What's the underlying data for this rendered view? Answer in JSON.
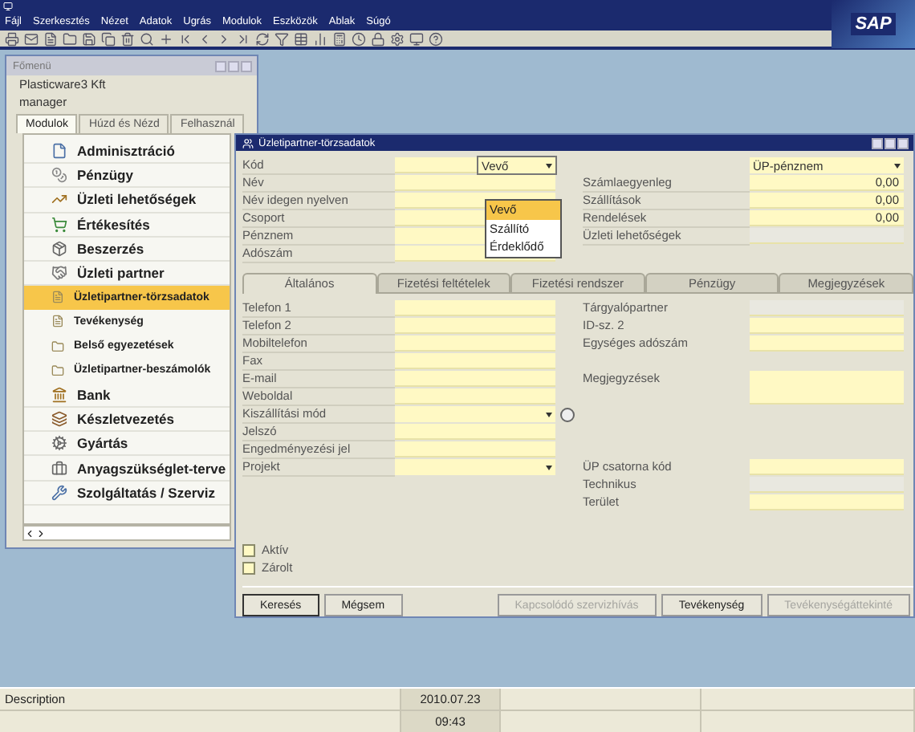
{
  "app": {
    "logo": "SAP",
    "menu": [
      "Fájl",
      "Szerkesztés",
      "Nézet",
      "Adatok",
      "Ugrás",
      "Modulok",
      "Eszközök",
      "Ablak",
      "Súgó"
    ]
  },
  "main_menu": {
    "title": "Főmenü",
    "company": "Plasticware3 Kft",
    "user": "manager",
    "tabs": [
      {
        "label": "Modulok",
        "selected": true
      },
      {
        "label": "Húzd és Nézd",
        "selected": false
      },
      {
        "label": "Felhasznál",
        "selected": false
      }
    ],
    "modules": [
      {
        "label": "Adminisztráció",
        "selected": false
      },
      {
        "label": "Pénzügy",
        "selected": false
      },
      {
        "label": "Üzleti lehetőségek",
        "selected": false
      },
      {
        "label": "Értékesítés",
        "selected": false
      },
      {
        "label": "Beszerzés",
        "selected": false
      },
      {
        "label": "Üzleti partner",
        "selected": false,
        "children": [
          {
            "label": "Üzletipartner-törzsadatok",
            "selected": true
          },
          {
            "label": "Tevékenység",
            "selected": false
          },
          {
            "label": "Belső egyezetések",
            "selected": false
          },
          {
            "label": "Üzletipartner-beszámolók",
            "selected": false
          }
        ]
      },
      {
        "label": "Bank",
        "selected": false
      },
      {
        "label": "Készletvezetés",
        "selected": false
      },
      {
        "label": "Gyártás",
        "selected": false
      },
      {
        "label": "Anyagszükséglet-terve",
        "selected": false
      },
      {
        "label": "Szolgáltatás / Szerviz",
        "selected": false
      }
    ]
  },
  "form": {
    "title": "Üzletipartner-törzsadatok",
    "code": {
      "label": "Kód",
      "type": "Vevő",
      "expanded": true,
      "options": [
        {
          "label": "Vevő",
          "selected": true
        },
        {
          "label": "Szállító",
          "selected": false
        },
        {
          "label": "Érdeklődő",
          "selected": false
        }
      ]
    },
    "header_left": [
      {
        "label": "Név",
        "kind": "text"
      },
      {
        "label": "Név idegen nyelven",
        "kind": "text"
      },
      {
        "label": "Csoport",
        "kind": "text"
      },
      {
        "label": "Pénznem",
        "kind": "dropdown"
      },
      {
        "label": "Adószám",
        "kind": "text"
      }
    ],
    "currency": "ÜP-pénznem",
    "header_right": [
      {
        "label": "Számlaegyenleg",
        "value": "0,00",
        "disabled": false
      },
      {
        "label": "Szállítások",
        "value": "0,00",
        "disabled": false
      },
      {
        "label": "Rendelések",
        "value": "0,00",
        "disabled": false
      },
      {
        "label": "Üzleti lehetőségek",
        "disabled": true
      }
    ],
    "tabs": [
      {
        "label": "Általános",
        "selected": true
      },
      {
        "label": "Fizetési feltételek",
        "selected": false
      },
      {
        "label": "Fizetési rendszer",
        "selected": false
      },
      {
        "label": "Pénzügy",
        "selected": false
      },
      {
        "label": "Megjegyzések",
        "selected": false
      }
    ],
    "general_left": [
      {
        "label": "Telefon 1",
        "kind": "text"
      },
      {
        "label": "Telefon 2",
        "kind": "text"
      },
      {
        "label": "Mobiltelefon",
        "kind": "text"
      },
      {
        "label": "Fax",
        "kind": "text"
      },
      {
        "label": "E-mail",
        "kind": "text"
      },
      {
        "label": "Weboldal",
        "kind": "text"
      },
      {
        "label": "Kiszállítási mód",
        "kind": "dropdown_link"
      },
      {
        "label": "Jelszó",
        "kind": "text"
      },
      {
        "label": "Engedményezési jel",
        "kind": "text"
      },
      {
        "label": "Projekt",
        "kind": "dropdown"
      }
    ],
    "general_right_top": [
      {
        "label": "Tárgyalópartner",
        "kind": "text",
        "disabled": true
      },
      {
        "label": "ID-sz. 2",
        "kind": "text",
        "disabled": false
      },
      {
        "label": "Egységes adószám",
        "kind": "text",
        "disabled": false
      },
      {
        "label": "Megjegyzések",
        "kind": "memo",
        "disabled": false
      }
    ],
    "general_right_bottom": [
      {
        "label": "ÜP csatorna kód",
        "kind": "text",
        "disabled": false
      },
      {
        "label": "Technikus",
        "kind": "text",
        "disabled": true
      },
      {
        "label": "Terület",
        "kind": "text",
        "disabled": false
      }
    ],
    "checkboxes": [
      {
        "label": "Aktív",
        "checked": false
      },
      {
        "label": "Zárolt",
        "checked": false
      }
    ],
    "buttons_left": [
      {
        "label": "Keresés",
        "disabled": false,
        "default": true
      },
      {
        "label": "Mégsem",
        "disabled": false,
        "default": false
      }
    ],
    "buttons_right": [
      {
        "label": "Kapcsolódó szervizhívás",
        "disabled": true,
        "default": false
      },
      {
        "label": "Tevékenység",
        "disabled": false,
        "default": false
      },
      {
        "label": "Tevékenységáttekinté",
        "disabled": true,
        "default": false
      }
    ]
  },
  "status_bar": {
    "description": "Description",
    "date": "2010.07.23",
    "time": "09:43"
  }
}
